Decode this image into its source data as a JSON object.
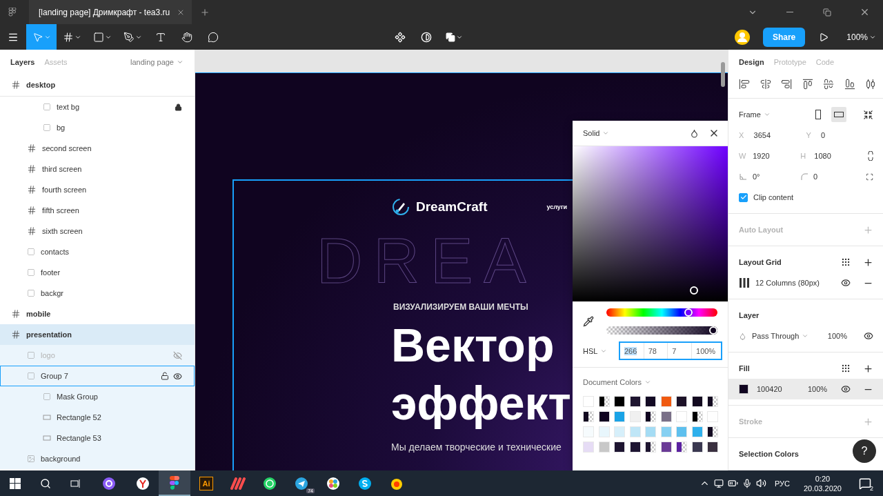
{
  "title_bar": {
    "tab_title": "[landing page] Дримкрафт - tea3.ru"
  },
  "toolbar": {
    "tools": [
      {
        "kind": "move",
        "selected": true,
        "menu": true
      },
      {
        "kind": "frame",
        "selected": false,
        "menu": true
      },
      {
        "kind": "shape",
        "selected": false,
        "menu": true
      },
      {
        "kind": "pen",
        "selected": false,
        "menu": true
      },
      {
        "kind": "text",
        "selected": false,
        "menu": false
      },
      {
        "kind": "hand",
        "selected": false,
        "menu": false
      },
      {
        "kind": "comment",
        "selected": false,
        "menu": false
      }
    ],
    "share": "Share",
    "zoom": "100%"
  },
  "left_panel": {
    "tabs": [
      {
        "label": "Layers",
        "selected": true
      },
      {
        "label": "Assets",
        "selected": false
      }
    ],
    "page": "landing page",
    "layers": [
      {
        "name": "desktop",
        "kind": "frame",
        "selected": false,
        "hovered": false,
        "hidden": false,
        "locked": false,
        "children": [
          {
            "children": [
              {
                "name": "text bg",
                "kind": "group",
                "selected": false,
                "hovered": false,
                "hidden": false,
                "locked": true
              },
              {
                "name": "bg",
                "kind": "group",
                "selected": false,
                "hovered": false,
                "hidden": false,
                "locked": false
              }
            ]
          },
          {
            "name": "second screen",
            "kind": "frame",
            "selected": false,
            "hovered": false,
            "hidden": false,
            "locked": false
          },
          {
            "name": "third screen",
            "kind": "frame",
            "selected": false,
            "hovered": false,
            "hidden": false,
            "locked": false
          },
          {
            "name": "fourth screen",
            "kind": "frame",
            "selected": false,
            "hovered": false,
            "hidden": false,
            "locked": false
          },
          {
            "name": "fifth screen",
            "kind": "frame",
            "selected": false,
            "hovered": false,
            "hidden": false,
            "locked": false
          },
          {
            "name": "sixth screen",
            "kind": "frame",
            "selected": false,
            "hovered": false,
            "hidden": false,
            "locked": false
          },
          {
            "name": "contacts",
            "kind": "group",
            "selected": false,
            "hovered": false,
            "hidden": false,
            "locked": false
          },
          {
            "name": "footer",
            "kind": "group",
            "selected": false,
            "hovered": false,
            "hidden": false,
            "locked": false
          },
          {
            "name": "backgr",
            "kind": "group",
            "selected": false,
            "hovered": false,
            "hidden": false,
            "locked": false
          }
        ]
      },
      {
        "name": "mobile",
        "kind": "frame",
        "selected": false,
        "hovered": false,
        "hidden": false,
        "locked": false
      },
      {
        "name": "presentation",
        "kind": "frame",
        "selected": true,
        "hovered": false,
        "hidden": false,
        "locked": false,
        "children": [
          {
            "name": "logo",
            "kind": "group",
            "selected": false,
            "hovered": false,
            "hidden": true,
            "locked": false
          },
          {
            "name": "Group 7",
            "kind": "group",
            "selected": false,
            "hovered": true,
            "hidden": false,
            "locked": false,
            "children": [
              {
                "name": "Mask Group",
                "kind": "group",
                "selected": false,
                "hovered": false,
                "hidden": false,
                "locked": false
              },
              {
                "name": "Rectangle 52",
                "kind": "rect",
                "selected": false,
                "hovered": false,
                "hidden": false,
                "locked": false
              },
              {
                "name": "Rectangle 53",
                "kind": "rect",
                "selected": false,
                "hovered": false,
                "hidden": false,
                "locked": false
              }
            ]
          },
          {
            "name": "background",
            "kind": "image",
            "selected": false,
            "hovered": false,
            "hidden": false,
            "locked": false
          }
        ]
      }
    ]
  },
  "canvas": {
    "brand": "DreamCraft",
    "nav": "услуги",
    "backdrop_word": "DREA",
    "eyebrow": "ВИЗУАЛИЗИРУЕМ ВАШИ МЕЧТЫ",
    "headline": [
      "Вектор",
      "эффект"
    ],
    "lead": "Мы делаем творческие и технические"
  },
  "color_picker": {
    "mode": "Solid",
    "hue": {
      "level": 0.74
    },
    "opacity": {
      "level": 1
    },
    "format": "HSL",
    "values": [
      {
        "value": "266",
        "selected": true
      },
      {
        "value": "78",
        "selected": false
      },
      {
        "value": "7",
        "selected": false
      },
      {
        "value": "100%",
        "selected": false
      }
    ],
    "swatches_title": "Document Colors",
    "swatches": [
      {
        "kind": "solid",
        "color": "#ffffff"
      },
      {
        "kind": "split",
        "color": "#000000"
      },
      {
        "kind": "solid",
        "color": "#000000"
      },
      {
        "kind": "solid",
        "color": "#1e1530"
      },
      {
        "kind": "solid",
        "color": "#130a24"
      },
      {
        "kind": "solid",
        "color": "#f05a10"
      },
      {
        "kind": "solid",
        "color": "#1d1228"
      },
      {
        "kind": "solid",
        "color": "#130a20"
      },
      {
        "kind": "split",
        "color": "#130a20"
      },
      {
        "kind": "split",
        "color": "#130a20"
      },
      {
        "kind": "solid",
        "color": "#100420"
      },
      {
        "kind": "solid",
        "color": "#1aa3e6"
      },
      {
        "kind": "solid",
        "color": "#f0f0f0"
      },
      {
        "kind": "split",
        "color": "#100420"
      },
      {
        "kind": "solid",
        "color": "#7a7088"
      },
      {
        "kind": "solid",
        "color": "#ffffff"
      },
      {
        "kind": "split",
        "color": "#000001"
      },
      {
        "kind": "solid",
        "color": "#fefefe"
      },
      {
        "kind": "solid",
        "color": "#f6fbfd"
      },
      {
        "kind": "solid",
        "color": "#e8f6fc"
      },
      {
        "kind": "solid",
        "color": "#d6effa"
      },
      {
        "kind": "solid",
        "color": "#bfe6f7"
      },
      {
        "kind": "solid",
        "color": "#a5dcf4"
      },
      {
        "kind": "solid",
        "color": "#86d0f2"
      },
      {
        "kind": "solid",
        "color": "#5ec0ee"
      },
      {
        "kind": "solid",
        "color": "#2fb0ec"
      },
      {
        "kind": "split",
        "color": "#130a21"
      },
      {
        "kind": "solid",
        "color": "#e6dcf5"
      },
      {
        "kind": "solid",
        "color": "#c8c8c8"
      },
      {
        "kind": "solid",
        "color": "#1e1531"
      },
      {
        "kind": "solid",
        "color": "#1e1532"
      },
      {
        "kind": "split",
        "color": "#1e1530"
      },
      {
        "kind": "solid",
        "color": "#6a3a96"
      },
      {
        "kind": "split",
        "color": "#5a20a0"
      },
      {
        "kind": "solid",
        "color": "#3a3850"
      },
      {
        "kind": "solid",
        "color": "#3a3040"
      }
    ]
  },
  "design_panel": {
    "tabs": [
      {
        "label": "Design",
        "selected": true
      },
      {
        "label": "Prototype",
        "selected": false
      },
      {
        "label": "Code",
        "selected": false
      }
    ],
    "sections": [
      {
        "kind": "frame",
        "title": "Frame",
        "orientations": [
          {
            "kind": "portrait",
            "selected": false
          },
          {
            "kind": "landscape",
            "selected": true
          }
        ],
        "fields": [
          {
            "kind": "label",
            "label": "X",
            "value": "3654"
          },
          {
            "kind": "label",
            "label": "Y",
            "value": "0"
          },
          {
            "kind": "label",
            "label": "W",
            "value": "1920"
          },
          {
            "kind": "label",
            "label": "H",
            "value": "1080"
          },
          {
            "kind": "angle",
            "value": "0°"
          },
          {
            "kind": "corner",
            "value": "0"
          }
        ],
        "clip": {
          "label": "Clip content",
          "checked": true
        }
      },
      {
        "kind": "header",
        "title": "Auto Layout",
        "disabled": true,
        "addable": true
      },
      {
        "kind": "grid",
        "title": "Layout Grid",
        "items": [
          {
            "label": "12 Columns (80px)",
            "visible": true
          }
        ]
      },
      {
        "kind": "layer",
        "title": "Layer",
        "blend": "Pass Through",
        "opacity": "100%",
        "visible": true
      },
      {
        "kind": "fill",
        "title": "Fill",
        "items": [
          {
            "hex": "100420",
            "color": "#100420",
            "opacity": "100%",
            "visible": true,
            "selected": true
          }
        ]
      },
      {
        "kind": "header",
        "title": "Stroke",
        "disabled": true,
        "addable": true
      },
      {
        "kind": "header",
        "title": "Selection Colors",
        "disabled": false
      }
    ],
    "help": "?"
  },
  "taskbar": {
    "apps": [
      {
        "kind": "assistant",
        "selected": false
      },
      {
        "kind": "browser",
        "selected": false
      },
      {
        "kind": "design",
        "selected": true
      },
      {
        "kind": "illustrator",
        "label": "Ai",
        "selected": false
      },
      {
        "kind": "notes",
        "selected": false
      },
      {
        "kind": "chat",
        "selected": false
      },
      {
        "kind": "messenger",
        "badge": "74",
        "selected": false
      },
      {
        "kind": "pinwheel",
        "selected": false
      },
      {
        "kind": "call",
        "selected": false
      },
      {
        "kind": "music",
        "selected": false
      }
    ],
    "language": "РУС",
    "time": "0:20",
    "date": "20.03.2020",
    "notifications": "2"
  }
}
